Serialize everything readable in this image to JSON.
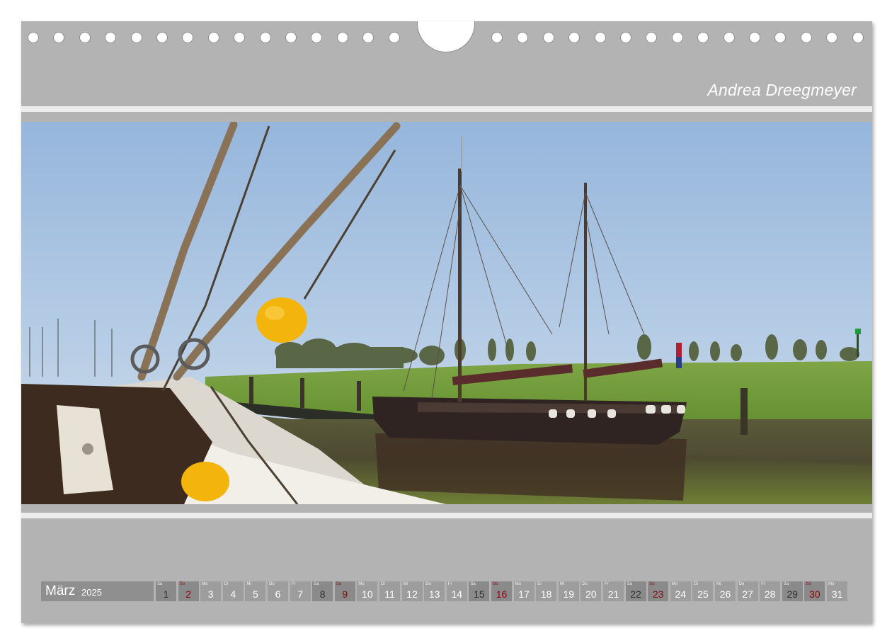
{
  "author": "Andrea Dreegmeyer",
  "calendar": {
    "month": "März",
    "year": "2025",
    "days": [
      {
        "dow": "Sa",
        "num": "1",
        "kind": "sat"
      },
      {
        "dow": "So",
        "num": "2",
        "kind": "sun"
      },
      {
        "dow": "Mo",
        "num": "3",
        "kind": "wd"
      },
      {
        "dow": "Di",
        "num": "4",
        "kind": "wd"
      },
      {
        "dow": "Mi",
        "num": "5",
        "kind": "wd"
      },
      {
        "dow": "Do",
        "num": "6",
        "kind": "wd"
      },
      {
        "dow": "Fr",
        "num": "7",
        "kind": "wd"
      },
      {
        "dow": "Sa",
        "num": "8",
        "kind": "sat"
      },
      {
        "dow": "So",
        "num": "9",
        "kind": "sun"
      },
      {
        "dow": "Mo",
        "num": "10",
        "kind": "wd"
      },
      {
        "dow": "Di",
        "num": "11",
        "kind": "wd"
      },
      {
        "dow": "Mi",
        "num": "12",
        "kind": "wd"
      },
      {
        "dow": "Do",
        "num": "13",
        "kind": "wd"
      },
      {
        "dow": "Fr",
        "num": "14",
        "kind": "wd"
      },
      {
        "dow": "Sa",
        "num": "15",
        "kind": "sat"
      },
      {
        "dow": "So",
        "num": "16",
        "kind": "sun"
      },
      {
        "dow": "Mo",
        "num": "17",
        "kind": "wd"
      },
      {
        "dow": "Di",
        "num": "18",
        "kind": "wd"
      },
      {
        "dow": "Mi",
        "num": "19",
        "kind": "wd"
      },
      {
        "dow": "Do",
        "num": "20",
        "kind": "wd"
      },
      {
        "dow": "Fr",
        "num": "21",
        "kind": "wd"
      },
      {
        "dow": "Sa",
        "num": "22",
        "kind": "sat"
      },
      {
        "dow": "So",
        "num": "23",
        "kind": "sun"
      },
      {
        "dow": "Mo",
        "num": "24",
        "kind": "wd"
      },
      {
        "dow": "Di",
        "num": "25",
        "kind": "wd"
      },
      {
        "dow": "Mi",
        "num": "26",
        "kind": "wd"
      },
      {
        "dow": "Do",
        "num": "27",
        "kind": "wd"
      },
      {
        "dow": "Fr",
        "num": "28",
        "kind": "wd"
      },
      {
        "dow": "Sa",
        "num": "29",
        "kind": "sat"
      },
      {
        "dow": "So",
        "num": "30",
        "kind": "sun"
      },
      {
        "dow": "Mo",
        "num": "31",
        "kind": "wd"
      }
    ]
  },
  "colors": {
    "frame": "#b3b3b3",
    "sunday": "#8b0a12",
    "sky": "#a9c3e0",
    "grass": "#6f9a35",
    "hull": "#2f2422",
    "buoy": "#f3b40c"
  }
}
